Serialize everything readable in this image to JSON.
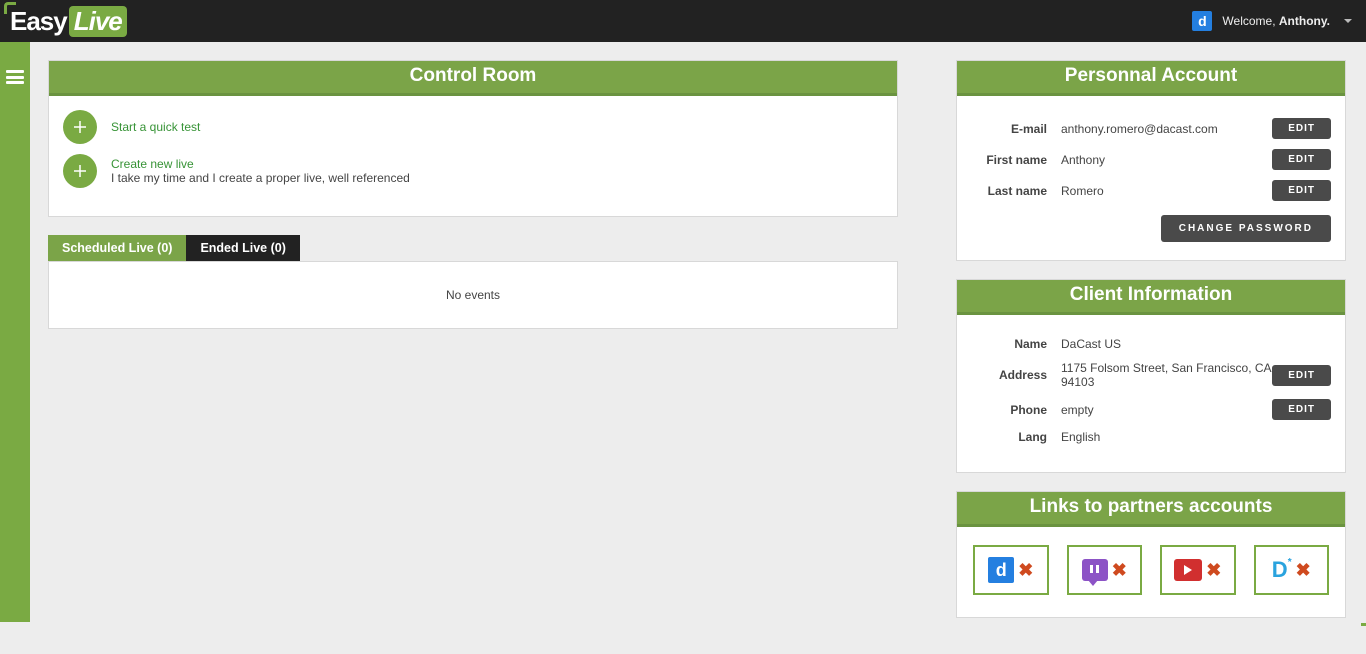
{
  "brand": {
    "easy": "Easy",
    "live": "Live"
  },
  "user": {
    "welcome_prefix": "Welcome, ",
    "name": "Anthony.",
    "avatar_letter": "d"
  },
  "control_room": {
    "title": "Control Room",
    "quick_test": "Start a quick test",
    "create_live_title": "Create new live",
    "create_live_sub": "I take my time and I create a proper live, well referenced",
    "tabs": {
      "scheduled": "Scheduled Live (0)",
      "ended": "Ended Live (0)"
    },
    "no_events": "No events"
  },
  "account": {
    "title": "Personnal Account",
    "labels": {
      "email": "E-mail",
      "first_name": "First name",
      "last_name": "Last name"
    },
    "values": {
      "email": "anthony.romero@dacast.com",
      "first_name": "Anthony",
      "last_name": "Romero"
    },
    "edit": "EDIT",
    "change_password": "CHANGE PASSWORD"
  },
  "client": {
    "title": "Client Information",
    "labels": {
      "name": "Name",
      "address": "Address",
      "phone": "Phone",
      "lang": "Lang"
    },
    "values": {
      "name": "DaCast US",
      "address": "1175 Folsom Street, San Francisco, CA 94103",
      "phone": "empty",
      "lang": "English"
    },
    "edit": "EDIT"
  },
  "partners": {
    "title": "Links to partners accounts"
  }
}
